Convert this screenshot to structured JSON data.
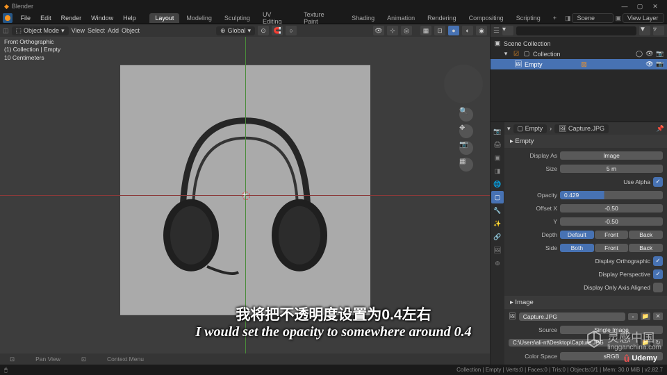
{
  "app": {
    "title": "Blender"
  },
  "window_controls": {
    "min": "—",
    "max": "▢",
    "close": "✕"
  },
  "menu": {
    "items": [
      "File",
      "Edit",
      "Render",
      "Window",
      "Help"
    ],
    "workspaces": [
      "Layout",
      "Modeling",
      "Sculpting",
      "UV Editing",
      "Texture Paint",
      "Shading",
      "Animation",
      "Rendering",
      "Compositing",
      "Scripting"
    ],
    "active_ws": "Layout",
    "scene_label": "Scene",
    "viewlayer_label": "View Layer"
  },
  "viewport": {
    "mode": "Object Mode",
    "menus": [
      "View",
      "Select",
      "Add",
      "Object"
    ],
    "orient": "Global",
    "info": {
      "line1": "Front Orthographic",
      "line2": "(1) Collection | Empty",
      "line3": "10 Centimeters"
    },
    "footer": {
      "a": "Pan View",
      "b": "Context Menu"
    }
  },
  "outliner": {
    "root": "Scene Collection",
    "collection": "Collection",
    "item": "Empty"
  },
  "props": {
    "breadcrumb": {
      "a": "Empty",
      "b": "Capture.JPG"
    },
    "panel_empty": "Empty",
    "display_as": {
      "label": "Display As",
      "value": "Image"
    },
    "size": {
      "label": "Size",
      "value": "5 m"
    },
    "use_alpha": {
      "label": "Use Alpha",
      "checked": true
    },
    "opacity": {
      "label": "Opacity",
      "value": "0.429"
    },
    "offset_x": {
      "label": "Offset X",
      "value": "-0.50"
    },
    "offset_y": {
      "label": "Y",
      "value": "-0.50"
    },
    "depth": {
      "label": "Depth",
      "opts": [
        "Default",
        "Front",
        "Back"
      ],
      "active": 0
    },
    "side": {
      "label": "Side",
      "opts": [
        "Both",
        "Front",
        "Back"
      ],
      "active": 0
    },
    "disp_ortho": {
      "label": "Display Orthographic",
      "checked": true
    },
    "disp_persp": {
      "label": "Display Perspective",
      "checked": true
    },
    "disp_axis": {
      "label": "Display Only Axis Aligned",
      "checked": false
    },
    "panel_image": "Image",
    "image_name": "Capture.JPG",
    "source": {
      "label": "Source",
      "value": "Single Image"
    },
    "filepath": "C:\\Users\\ali-nt\\Desktop\\Capture.JPG",
    "colorspace": {
      "label": "Color Space",
      "value": "sRGB"
    }
  },
  "status": {
    "right": "Collection | Empty | Verts:0 | Faces:0 | Tris:0 | Objects:0/1 | Mem: 30.0 MiB | v2.82.7"
  },
  "subtitle": {
    "cn": "我将把不透明度设置为0.4左右",
    "en": "I would set the opacity to somewhere around 0.4"
  },
  "watermark": {
    "main": "灵感中国",
    "sub": "lingganchina.com"
  },
  "udemy": "Udemy"
}
